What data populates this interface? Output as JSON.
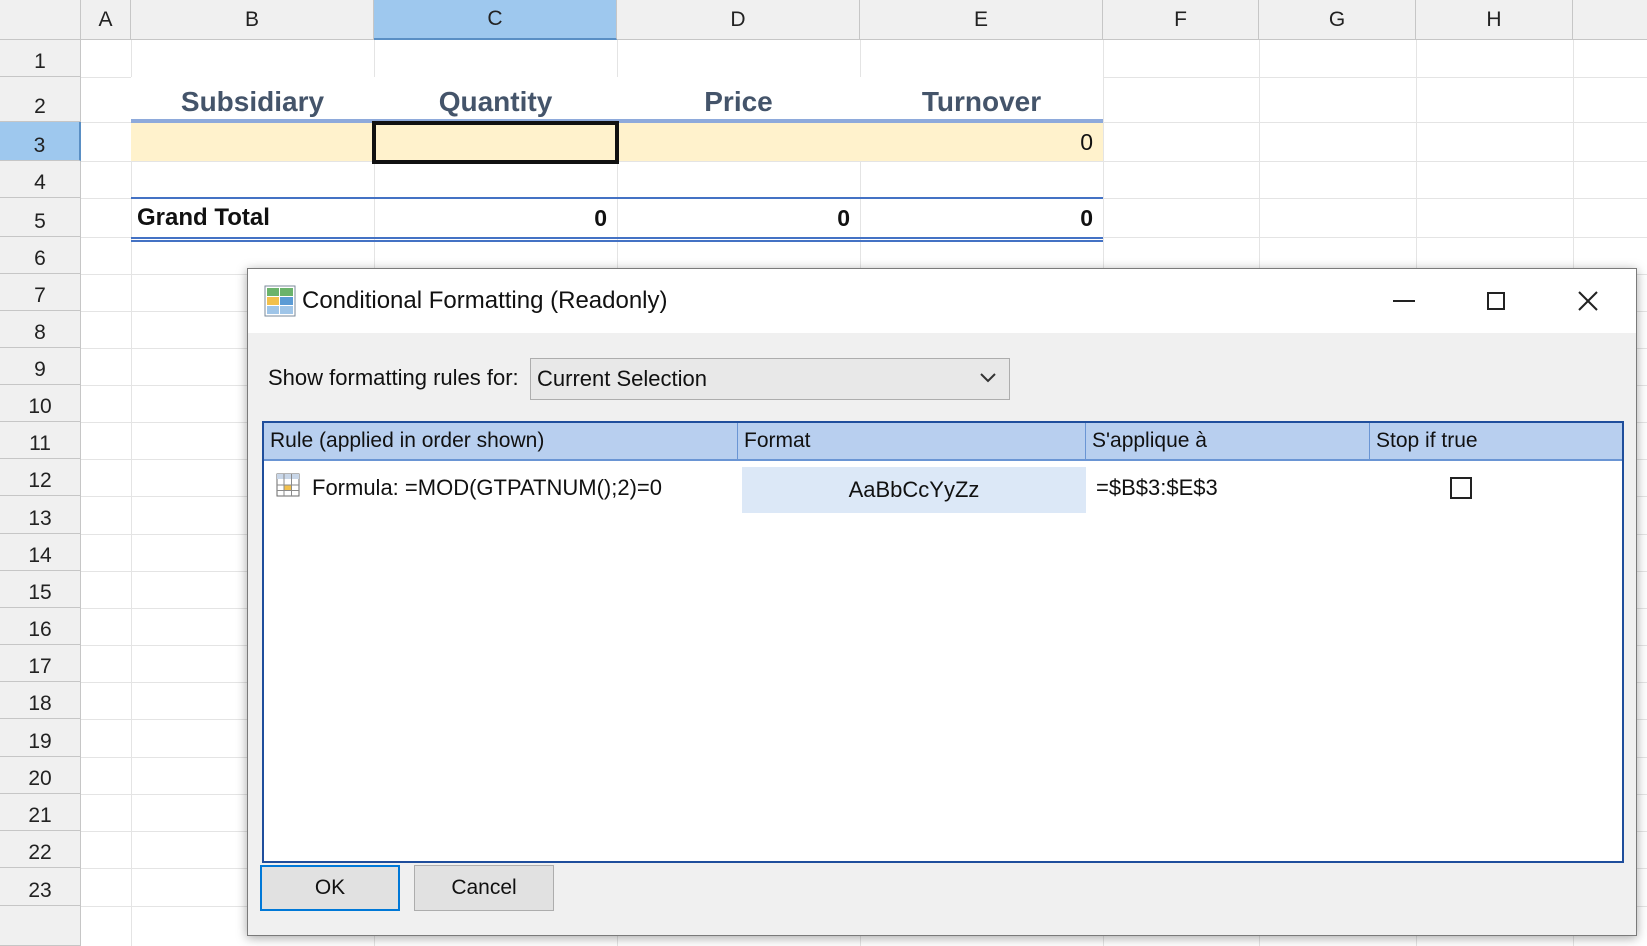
{
  "sheet": {
    "columns": [
      "A",
      "B",
      "C",
      "D",
      "E",
      "F",
      "G",
      "H"
    ],
    "rows": [
      "1",
      "2",
      "3",
      "4",
      "5",
      "6",
      "7",
      "8",
      "9",
      "10",
      "11",
      "12",
      "13",
      "14",
      "15",
      "16",
      "17",
      "18",
      "19",
      "20",
      "21",
      "22",
      "23"
    ],
    "selected_column": "C",
    "selected_row": "3",
    "table": {
      "headers": [
        "Subsidiary",
        "Quantity",
        "Price",
        "Turnover"
      ],
      "row3_turnover": "0",
      "grand_total_label": "Grand Total",
      "grand_total_values": [
        "0",
        "0",
        "0"
      ]
    },
    "colors": {
      "header_text": "#44546a",
      "band_fill": "#fff2cc",
      "selection_header": "#9ec8ee"
    }
  },
  "dialog": {
    "title": "Conditional Formatting (Readonly)",
    "icon": "conditional-format-icon",
    "window_controls": {
      "minimize": "—",
      "maximize": "☐",
      "close": "✕"
    },
    "show_label": "Show formatting rules for:",
    "show_value": "Current Selection",
    "grid": {
      "headers": [
        "Rule (applied in order shown)",
        "Format",
        "S'applique à",
        "Stop if true"
      ],
      "rows": [
        {
          "rule": "Formula: =MOD(GTPATNUM();2)=0",
          "format": "AaBbCcYyZz",
          "applies_to": "=$B$3:$E$3",
          "stop_if_true": false
        }
      ]
    },
    "ok_label": "OK",
    "cancel_label": "Cancel",
    "colors": {
      "grid_header": "#b8cfef",
      "grid_border": "#1f4e9c",
      "format_sample": "#dce8f7",
      "ok_border": "#0078d7"
    }
  }
}
